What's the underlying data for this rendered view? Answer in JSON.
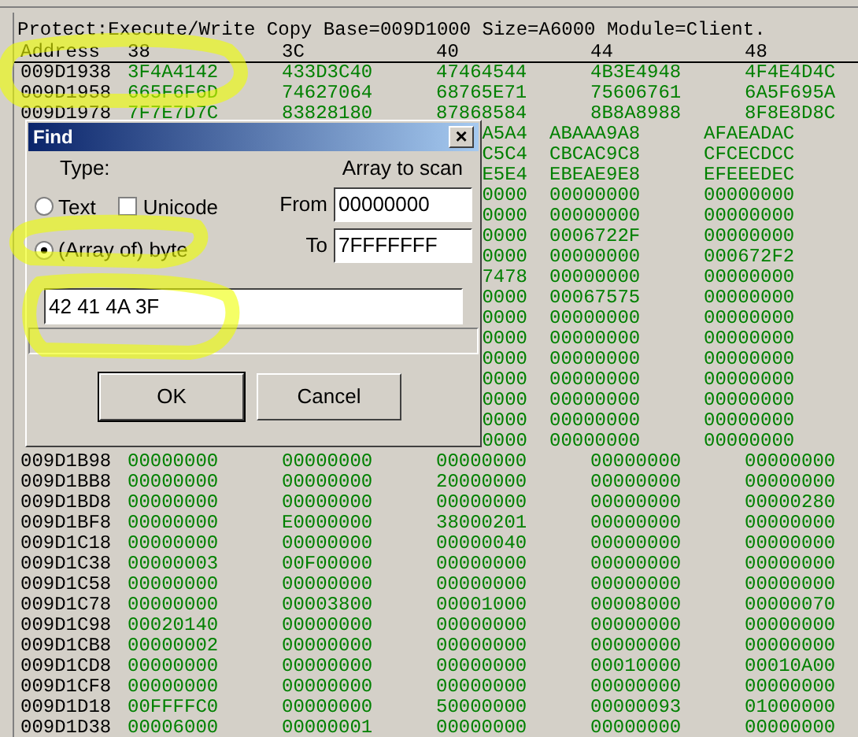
{
  "memory_view": {
    "info": "Protect:Execute/Write Copy  Base=009D1000 Size=A6000 Module=Client.",
    "columns": [
      "Address",
      "38",
      "3C",
      "40",
      "44",
      "48"
    ],
    "rows": [
      {
        "covered": false,
        "cells": [
          "009D1938",
          "3F4A4142",
          "433D3C40",
          "47464544",
          "4B3E4948",
          "4F4E4D4C"
        ]
      },
      {
        "covered": false,
        "cells": [
          "009D1958",
          "665F6F6D",
          "74627064",
          "68765E71",
          "75606761",
          "6A5F695A"
        ]
      },
      {
        "covered": false,
        "cells": [
          "009D1978",
          "7F7E7D7C",
          "83828180",
          "87868584",
          "8B8A8988",
          "8F8E8D8C"
        ]
      },
      {
        "covered": true,
        "cells": [
          "A5A4",
          "ABAAA9A8",
          "AFAEADAC"
        ]
      },
      {
        "covered": true,
        "cells": [
          "C5C4",
          "CBCAC9C8",
          "CFCECDCC"
        ]
      },
      {
        "covered": true,
        "cells": [
          "E5E4",
          "EBEAE9E8",
          "EFEEEDEC"
        ]
      },
      {
        "covered": true,
        "cells": [
          "0000",
          "00000000",
          "00000000"
        ]
      },
      {
        "covered": true,
        "cells": [
          "0000",
          "00000000",
          "00000000"
        ]
      },
      {
        "covered": true,
        "cells": [
          "0000",
          "0006722F",
          "00000000"
        ]
      },
      {
        "covered": true,
        "cells": [
          "0000",
          "00000000",
          "000672F2"
        ]
      },
      {
        "covered": true,
        "cells": [
          "7478",
          "00000000",
          "00000000"
        ]
      },
      {
        "covered": true,
        "cells": [
          "0000",
          "00067575",
          "00000000"
        ]
      },
      {
        "covered": true,
        "cells": [
          "0000",
          "00000000",
          "00000000"
        ]
      },
      {
        "covered": true,
        "cells": [
          "0000",
          "00000000",
          "00000000"
        ]
      },
      {
        "covered": true,
        "cells": [
          "0000",
          "00000000",
          "00000000"
        ]
      },
      {
        "covered": true,
        "cells": [
          "0000",
          "00000000",
          "00000000"
        ]
      },
      {
        "covered": true,
        "cells": [
          "0000",
          "00000000",
          "00000000"
        ]
      },
      {
        "covered": true,
        "cells": [
          "0000",
          "00000000",
          "00000000"
        ]
      },
      {
        "covered": true,
        "cells": [
          "0000",
          "00000000",
          "00000000"
        ]
      },
      {
        "covered": false,
        "cells": [
          "009D1B98",
          "00000000",
          "00000000",
          "00000000",
          "00000000",
          "00000000"
        ]
      },
      {
        "covered": false,
        "cells": [
          "009D1BB8",
          "00000000",
          "00000000",
          "20000000",
          "00000000",
          "00000000"
        ]
      },
      {
        "covered": false,
        "cells": [
          "009D1BD8",
          "00000000",
          "00000000",
          "00000000",
          "00000000",
          "00000280"
        ]
      },
      {
        "covered": false,
        "cells": [
          "009D1BF8",
          "00000000",
          "E0000000",
          "38000201",
          "00000000",
          "00000000"
        ]
      },
      {
        "covered": false,
        "cells": [
          "009D1C18",
          "00000000",
          "00000000",
          "00000040",
          "00000000",
          "00000000"
        ]
      },
      {
        "covered": false,
        "cells": [
          "009D1C38",
          "00000003",
          "00F00000",
          "00000000",
          "00000000",
          "00000000"
        ]
      },
      {
        "covered": false,
        "cells": [
          "009D1C58",
          "00000000",
          "00000000",
          "00000000",
          "00000000",
          "00000000"
        ]
      },
      {
        "covered": false,
        "cells": [
          "009D1C78",
          "00000000",
          "00003800",
          "00001000",
          "00008000",
          "00000070"
        ]
      },
      {
        "covered": false,
        "cells": [
          "009D1C98",
          "00020140",
          "00000000",
          "00000000",
          "00000000",
          "00000000"
        ]
      },
      {
        "covered": false,
        "cells": [
          "009D1CB8",
          "00000002",
          "00000000",
          "00000000",
          "00000000",
          "00000000"
        ]
      },
      {
        "covered": false,
        "cells": [
          "009D1CD8",
          "00000000",
          "00000000",
          "00000000",
          "00010000",
          "00010A00"
        ]
      },
      {
        "covered": false,
        "cells": [
          "009D1CF8",
          "00000000",
          "00000000",
          "00000000",
          "00000000",
          "00000000"
        ]
      },
      {
        "covered": false,
        "cells": [
          "009D1D18",
          "00FFFFC0",
          "00000000",
          "50000000",
          "00000093",
          "01000000"
        ]
      },
      {
        "covered": false,
        "cells": [
          "009D1D38",
          "00006000",
          "00000001",
          "00000000",
          "00000000",
          "00000000"
        ]
      }
    ]
  },
  "find_dialog": {
    "title": "Find",
    "close": "×",
    "type_label": "Type:",
    "scan_label": "Array to scan",
    "type_options": [
      {
        "label": "Text",
        "selected": false
      },
      {
        "label": "(Array of) byte",
        "selected": true
      }
    ],
    "unicode": {
      "label": "Unicode",
      "checked": false
    },
    "from": {
      "label": "From",
      "value": "00000000"
    },
    "to": {
      "label": "To",
      "value": "7FFFFFFF"
    },
    "search_value": "42 41 4A 3F",
    "buttons": [
      "OK",
      "Cancel"
    ]
  }
}
